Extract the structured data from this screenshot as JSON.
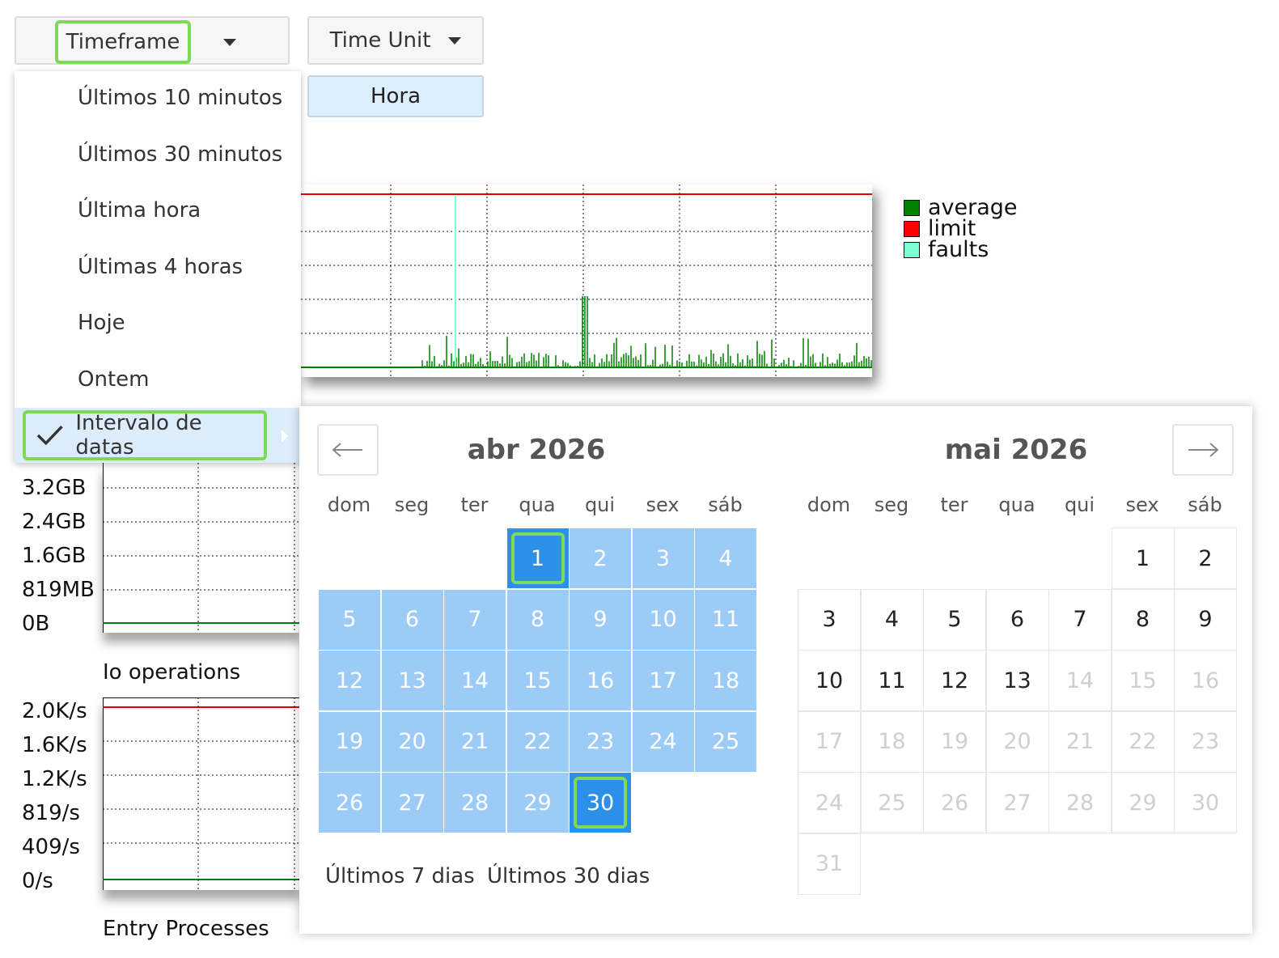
{
  "toolbar": {
    "timeframe_label": "Timeframe",
    "time_unit_label": "Time Unit",
    "time_unit_value": "Hora"
  },
  "timeframe_menu": {
    "items": [
      "Últimos 10 minutos",
      "Últimos 30 minutos",
      "Última hora",
      "Últimas 4 horas",
      "Hoje",
      "Ontem",
      "Intervalo de datas"
    ],
    "selected_index": 6
  },
  "legend": {
    "items": [
      {
        "label": "average",
        "color": "#008000"
      },
      {
        "label": "limit",
        "color": "#ff0000"
      },
      {
        "label": "faults",
        "color": "#7fffd4"
      }
    ]
  },
  "memory_chart": {
    "y_ticks": [
      "3.2GB",
      "2.4GB",
      "1.6GB",
      "819MB",
      "0B"
    ]
  },
  "io_chart": {
    "title": "Io operations",
    "y_ticks": [
      "2.0K/s",
      "1.6K/s",
      "1.2K/s",
      "819/s",
      "409/s",
      "0/s"
    ]
  },
  "entry_chart": {
    "title": "Entry Processes"
  },
  "calendar": {
    "prev_icon": "arrow-left-icon",
    "next_icon": "arrow-right-icon",
    "weekdays": [
      "dom",
      "seg",
      "ter",
      "qua",
      "qui",
      "sex",
      "sáb"
    ],
    "left_month": {
      "title": "abr 2026",
      "first_weekday": 3,
      "days": 30,
      "range_start": 1,
      "range_end": 30
    },
    "right_month": {
      "title": "mai 2026",
      "first_weekday": 5,
      "days": 31,
      "last_enabled": 13
    },
    "quick_ranges": [
      "Últimos 7 dias",
      "Últimos 30 dias"
    ]
  },
  "colors": {
    "accent_ring": "#7ed957",
    "range_fill": "#9ccbf7",
    "range_endpoint": "#2c8fe8",
    "selected_menu_bg": "#dcecfb"
  }
}
